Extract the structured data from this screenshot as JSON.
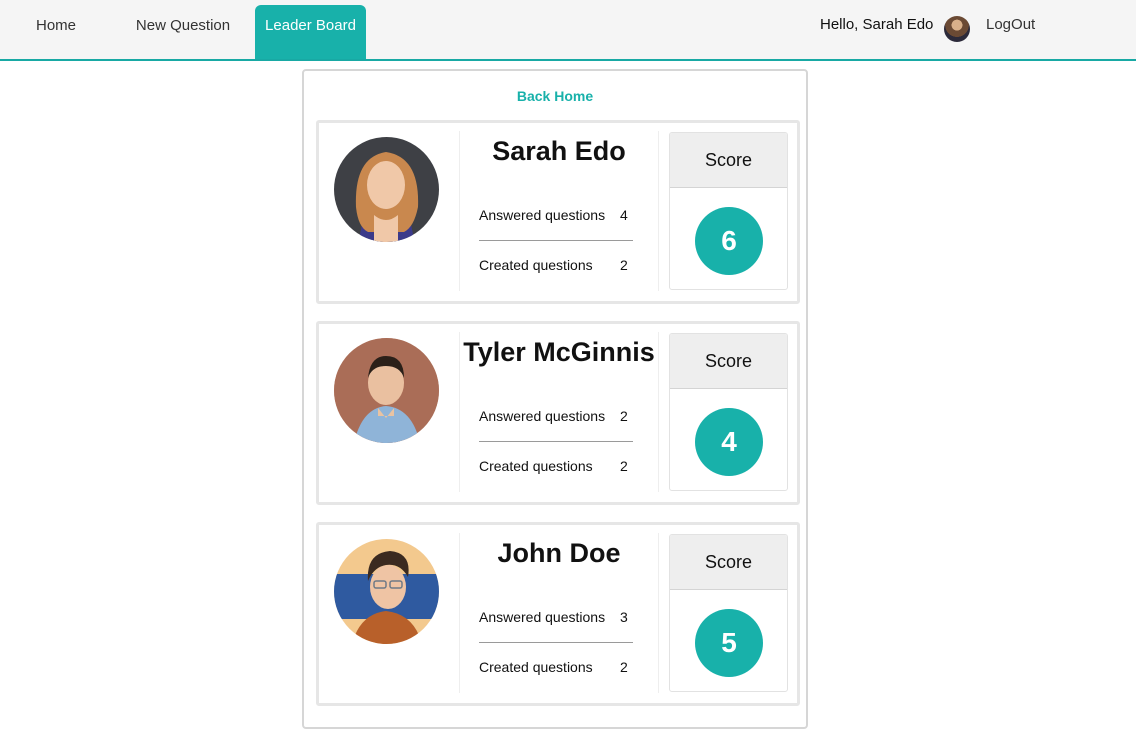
{
  "nav": {
    "home": "Home",
    "new_question": "New Question",
    "leader_board": "Leader Board",
    "greeting": "Hello, Sarah Edo",
    "logout": "LogOut",
    "active_color": "#18b1aa"
  },
  "back_home": "Back Home",
  "score_label": "Score",
  "users": [
    {
      "name": "Sarah Edo",
      "answered_label": "Answered questions",
      "answered": "4",
      "created_label": "Created questions",
      "created": "2",
      "score": "6"
    },
    {
      "name": "Tyler McGinnis",
      "answered_label": "Answered questions",
      "answered": "2",
      "created_label": "Created questions",
      "created": "2",
      "score": "4"
    },
    {
      "name": "John Doe",
      "answered_label": "Answered questions",
      "answered": "3",
      "created_label": "Created questions",
      "created": "2",
      "score": "5"
    }
  ]
}
